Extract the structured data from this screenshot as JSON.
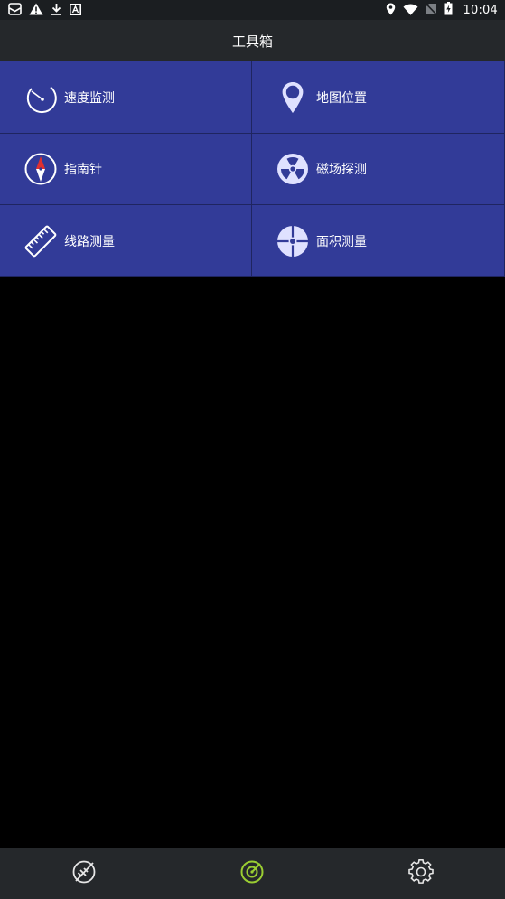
{
  "status_bar": {
    "time": "10:04",
    "left_icons": [
      "mail-icon",
      "warning-icon",
      "download-icon",
      "app-notification-icon"
    ],
    "right_icons": [
      "location-icon",
      "wifi-icon",
      "no-sim-icon",
      "battery-charging-icon"
    ]
  },
  "toolbar": {
    "title": "工具箱"
  },
  "tools": [
    {
      "label": "速度监测",
      "icon": "speedometer-icon"
    },
    {
      "label": "地图位置",
      "icon": "map-pin-icon"
    },
    {
      "label": "指南针",
      "icon": "compass-icon"
    },
    {
      "label": "磁场探测",
      "icon": "radiation-icon"
    },
    {
      "label": "线路测量",
      "icon": "ruler-icon"
    },
    {
      "label": "面积测量",
      "icon": "crosshair-icon"
    }
  ],
  "bottom_nav": [
    {
      "icon": "satellite-off-icon",
      "active": false
    },
    {
      "icon": "radar-icon",
      "active": true
    },
    {
      "icon": "settings-gear-icon",
      "active": false
    }
  ],
  "colors": {
    "tile_bg": "#323b98",
    "toolbar_bg": "#25282b",
    "active_nav": "#9acd32",
    "compass_needle": "#e03030"
  }
}
